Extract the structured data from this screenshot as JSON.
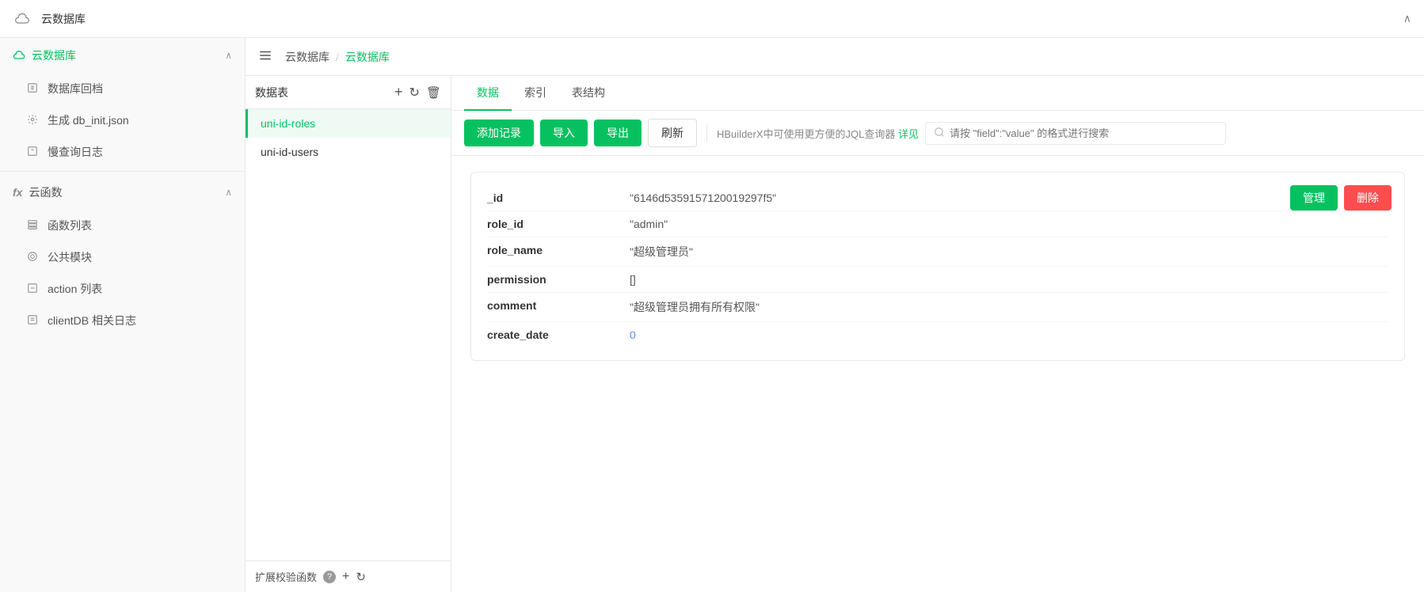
{
  "topHeader": {
    "icon": "☁",
    "title": "云数据库",
    "collapseLabel": "∧"
  },
  "breadcrumb": {
    "menuIcon": "☰",
    "items": [
      "云数据库"
    ],
    "separator": "/",
    "current": "云数据库"
  },
  "sidebar": {
    "cloudDb": {
      "icon": "☁",
      "label": "云数据库",
      "chevron": "∧"
    },
    "items": [
      {
        "icon": "▣",
        "label": "数据库回档"
      },
      {
        "icon": "⚙",
        "label": "生成 db_init.json"
      },
      {
        "icon": "▣",
        "label": "慢查询日志"
      }
    ],
    "cloudFn": {
      "fxIcon": "fx",
      "label": "云函数",
      "chevron": "∧"
    },
    "fnItems": [
      {
        "icon": "≡",
        "label": "函数列表"
      },
      {
        "icon": "◎",
        "label": "公共模块"
      },
      {
        "icon": "▣",
        "label": "action 列表"
      },
      {
        "icon": "▣",
        "label": "clientDB 相关日志"
      }
    ]
  },
  "tableList": {
    "header": {
      "title": "数据表",
      "addIcon": "+",
      "refreshIcon": "↻",
      "deleteIcon": "🗑"
    },
    "items": [
      {
        "name": "uni-id-roles",
        "active": true
      },
      {
        "name": "uni-id-users",
        "active": false
      }
    ],
    "footer": {
      "label": "扩展校验函数",
      "helpIcon": "?",
      "addIcon": "+",
      "refreshIcon": "↻"
    }
  },
  "tabs": [
    {
      "label": "数据",
      "active": true
    },
    {
      "label": "索引",
      "active": false
    },
    {
      "label": "表结构",
      "active": false
    }
  ],
  "toolbar": {
    "addRecordBtn": "添加记录",
    "importBtn": "导入",
    "exportBtn": "导出",
    "refreshBtn": "刷新",
    "hint": "HBuilderX中可使用更方便的JQL查询器",
    "hintLink": "详见",
    "searchPlaceholder": "请按 \"field\":\"value\" 的格式进行搜索"
  },
  "record": {
    "fields": [
      {
        "key": "_id",
        "value": "\"6146d5359157120019297f5\"",
        "blue": false
      },
      {
        "key": "role_id",
        "value": "\"admin\"",
        "blue": false
      },
      {
        "key": "role_name",
        "value": "\"超级管理员\"",
        "blue": false
      },
      {
        "key": "permission",
        "value": "[]",
        "blue": false
      },
      {
        "key": "comment",
        "value": "\"超级管理员拥有所有权限\"",
        "blue": false
      },
      {
        "key": "create_date",
        "value": "0",
        "blue": true
      }
    ],
    "manageBtn": "管理",
    "deleteBtn": "删除"
  }
}
